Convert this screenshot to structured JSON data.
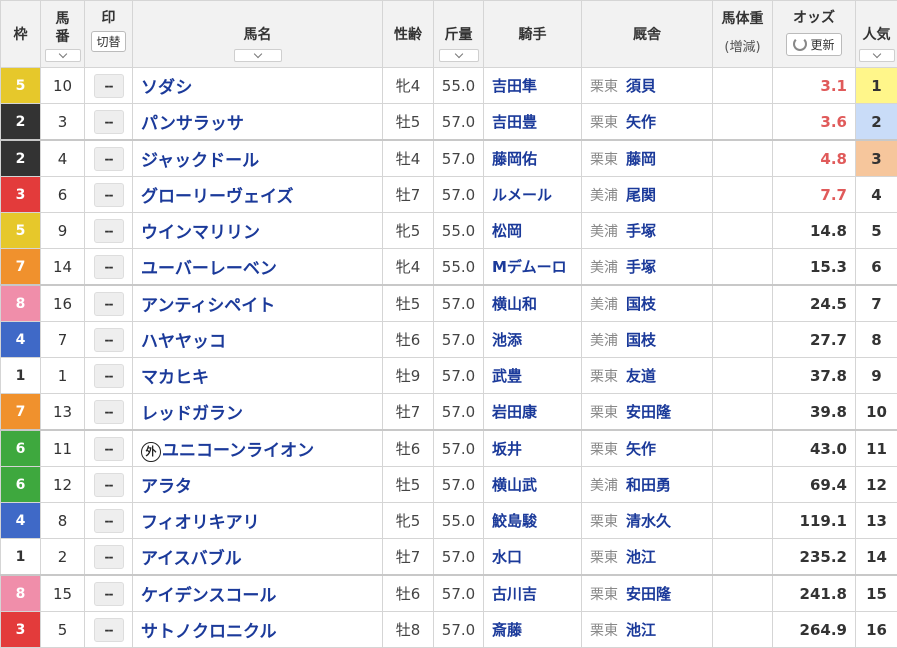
{
  "headers": {
    "waku": "枠",
    "umaban_1": "馬",
    "umaban_2": "番",
    "mark": "印",
    "mark_toggle": "切替",
    "name": "馬名",
    "sexage": "性齢",
    "kinryo": "斤量",
    "jockey": "騎手",
    "stable": "厩舎",
    "weight": "馬体重",
    "weight_sub": "(増減)",
    "odds": "オッズ",
    "refresh": "更新",
    "popularity": "人気"
  },
  "mark_placeholder": "--",
  "foreign_badge": "外",
  "rows": [
    {
      "waku": "5",
      "umaban": "10",
      "name": "ソダシ",
      "sexage": "牝4",
      "kinryo": "55.0",
      "jockey": "吉田隼",
      "area": "栗東",
      "trainer": "須貝",
      "odds": "3.1",
      "pop": "1"
    },
    {
      "waku": "2",
      "umaban": "3",
      "name": "パンサラッサ",
      "sexage": "牡5",
      "kinryo": "57.0",
      "jockey": "吉田豊",
      "area": "栗東",
      "trainer": "矢作",
      "odds": "3.6",
      "pop": "2"
    },
    {
      "waku": "2",
      "umaban": "4",
      "name": "ジャックドール",
      "sexage": "牡4",
      "kinryo": "57.0",
      "jockey": "藤岡佑",
      "area": "栗東",
      "trainer": "藤岡",
      "odds": "4.8",
      "pop": "3"
    },
    {
      "waku": "3",
      "umaban": "6",
      "name": "グローリーヴェイズ",
      "sexage": "牡7",
      "kinryo": "57.0",
      "jockey": "ルメール",
      "area": "美浦",
      "trainer": "尾関",
      "odds": "7.7",
      "pop": "4"
    },
    {
      "waku": "5",
      "umaban": "9",
      "name": "ウインマリリン",
      "sexage": "牝5",
      "kinryo": "55.0",
      "jockey": "松岡",
      "area": "美浦",
      "trainer": "手塚",
      "odds": "14.8",
      "pop": "5"
    },
    {
      "waku": "7",
      "umaban": "14",
      "name": "ユーバーレーベン",
      "sexage": "牝4",
      "kinryo": "55.0",
      "jockey": "Mデムーロ",
      "area": "美浦",
      "trainer": "手塚",
      "odds": "15.3",
      "pop": "6"
    },
    {
      "waku": "8",
      "umaban": "16",
      "name": "アンティシペイト",
      "sexage": "牡5",
      "kinryo": "57.0",
      "jockey": "横山和",
      "area": "美浦",
      "trainer": "国枝",
      "odds": "24.5",
      "pop": "7"
    },
    {
      "waku": "4",
      "umaban": "7",
      "name": "ハヤヤッコ",
      "sexage": "牡6",
      "kinryo": "57.0",
      "jockey": "池添",
      "area": "美浦",
      "trainer": "国枝",
      "odds": "27.7",
      "pop": "8"
    },
    {
      "waku": "1",
      "umaban": "1",
      "name": "マカヒキ",
      "sexage": "牡9",
      "kinryo": "57.0",
      "jockey": "武豊",
      "area": "栗東",
      "trainer": "友道",
      "odds": "37.8",
      "pop": "9"
    },
    {
      "waku": "7",
      "umaban": "13",
      "name": "レッドガラン",
      "sexage": "牡7",
      "kinryo": "57.0",
      "jockey": "岩田康",
      "area": "栗東",
      "trainer": "安田隆",
      "odds": "39.8",
      "pop": "10"
    },
    {
      "waku": "6",
      "umaban": "11",
      "name": "ユニコーンライオン",
      "foreign": true,
      "sexage": "牡6",
      "kinryo": "57.0",
      "jockey": "坂井",
      "area": "栗東",
      "trainer": "矢作",
      "odds": "43.0",
      "pop": "11"
    },
    {
      "waku": "6",
      "umaban": "12",
      "name": "アラタ",
      "sexage": "牡5",
      "kinryo": "57.0",
      "jockey": "横山武",
      "area": "美浦",
      "trainer": "和田勇",
      "odds": "69.4",
      "pop": "12"
    },
    {
      "waku": "4",
      "umaban": "8",
      "name": "フィオリキアリ",
      "sexage": "牝5",
      "kinryo": "55.0",
      "jockey": "鮫島駿",
      "area": "栗東",
      "trainer": "清水久",
      "odds": "119.1",
      "pop": "13"
    },
    {
      "waku": "1",
      "umaban": "2",
      "name": "アイスバブル",
      "sexage": "牡7",
      "kinryo": "57.0",
      "jockey": "水口",
      "area": "栗東",
      "trainer": "池江",
      "odds": "235.2",
      "pop": "14"
    },
    {
      "waku": "8",
      "umaban": "15",
      "name": "ケイデンスコール",
      "sexage": "牡6",
      "kinryo": "57.0",
      "jockey": "古川吉",
      "area": "栗東",
      "trainer": "安田隆",
      "odds": "241.8",
      "pop": "15"
    },
    {
      "waku": "3",
      "umaban": "5",
      "name": "サトノクロニクル",
      "sexage": "牡8",
      "kinryo": "57.0",
      "jockey": "斎藤",
      "area": "栗東",
      "trainer": "池江",
      "odds": "264.9",
      "pop": "16"
    }
  ],
  "colors": {
    "hot_odds": "#e05a5a",
    "link_blue": "#1b3a9a",
    "pop1": "#fff68a",
    "pop2": "#c9dcf8",
    "pop3": "#f6c69c"
  }
}
